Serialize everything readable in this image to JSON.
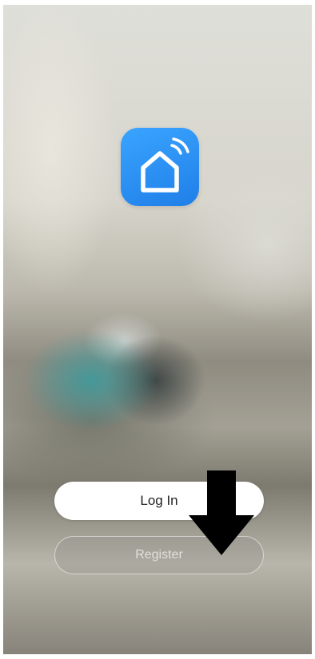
{
  "app": {
    "logo_icon": "smart-home-wifi-icon",
    "accent_color": "#2b91f5"
  },
  "auth": {
    "login_label": "Log In",
    "register_label": "Register"
  },
  "annotation": {
    "arrow_icon": "down-arrow-icon",
    "arrow_color": "#000000"
  }
}
